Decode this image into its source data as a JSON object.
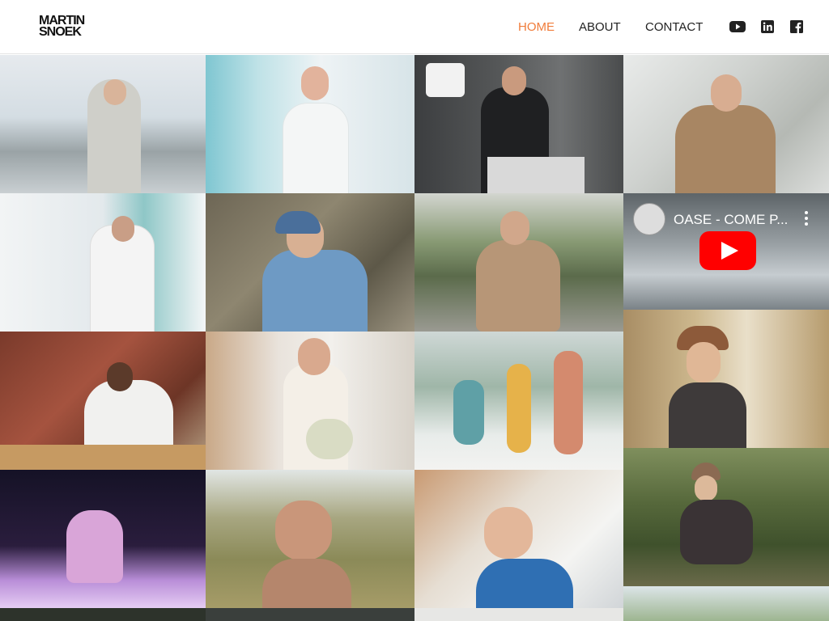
{
  "logo": {
    "line1": "MARTIN",
    "line2": "SNOEK"
  },
  "nav": [
    {
      "label": "HOME",
      "active": true
    },
    {
      "label": "ABOUT",
      "active": false
    },
    {
      "label": "CONTACT",
      "active": false
    }
  ],
  "social": [
    "youtube-icon",
    "linkedin-icon",
    "facebook-icon"
  ],
  "colors": {
    "accent": "#f07c3a",
    "text": "#222222"
  },
  "video": {
    "title": "OASE - COME P..."
  }
}
